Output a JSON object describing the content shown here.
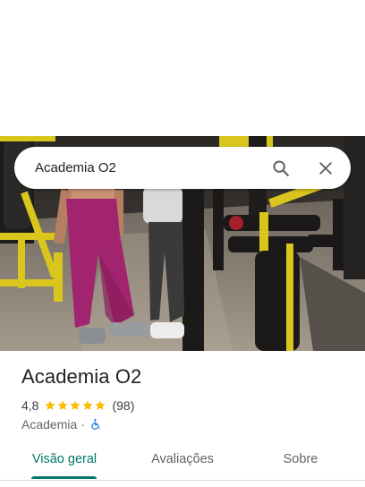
{
  "search": {
    "query": "Academia O2",
    "search_icon": "search-icon",
    "close_icon": "close-icon"
  },
  "place": {
    "name": "Academia O2",
    "rating": "4,8",
    "rating_value": 4.8,
    "stars_max": 5,
    "review_count": "(98)",
    "category": "Academia",
    "separator": "·",
    "accessibility_icon": "wheelchair-accessible-icon"
  },
  "tabs": [
    {
      "label": "Visão geral",
      "active": true
    },
    {
      "label": "Avaliações",
      "active": false
    },
    {
      "label": "Sobre",
      "active": false
    }
  ],
  "colors": {
    "accent": "#00796b",
    "star": "#fbbc04",
    "accessibility": "#1a73e8",
    "gym_yellow": "#e8d21f",
    "leggings": "#a3246e"
  }
}
